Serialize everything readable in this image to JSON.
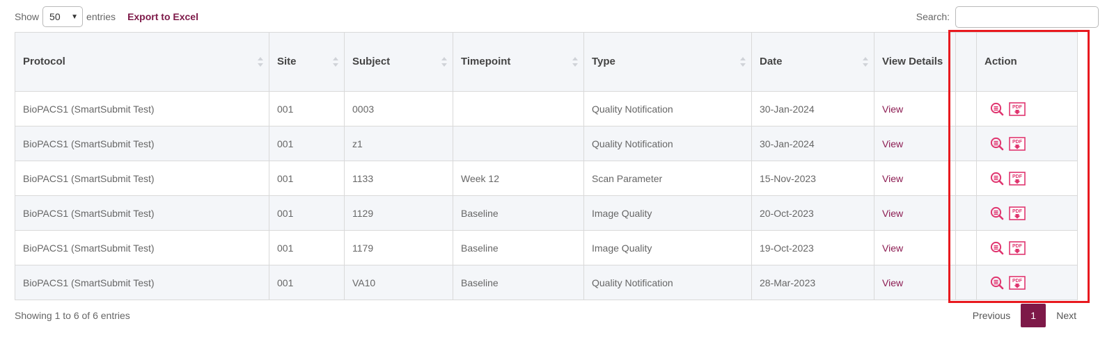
{
  "length_control": {
    "show_label": "Show",
    "selected": "50",
    "entries_label": "entries"
  },
  "export_label": "Export to Excel",
  "search": {
    "label": "Search:",
    "value": "",
    "placeholder": ""
  },
  "columns": [
    "Protocol",
    "Site",
    "Subject",
    "Timepoint",
    "Type",
    "Date",
    "View Details",
    "",
    "Action"
  ],
  "rows": [
    {
      "protocol": "BioPACS1 (SmartSubmit Test)",
      "site": "001",
      "subject": "0003",
      "timepoint": "",
      "type": "Quality Notification",
      "date": "30-Jan-2024",
      "view": "View"
    },
    {
      "protocol": "BioPACS1 (SmartSubmit Test)",
      "site": "001",
      "subject": "z1",
      "timepoint": "",
      "type": "Quality Notification",
      "date": "30-Jan-2024",
      "view": "View"
    },
    {
      "protocol": "BioPACS1 (SmartSubmit Test)",
      "site": "001",
      "subject": "1133",
      "timepoint": "Week 12",
      "type": "Scan Parameter",
      "date": "15-Nov-2023",
      "view": "View"
    },
    {
      "protocol": "BioPACS1 (SmartSubmit Test)",
      "site": "001",
      "subject": "1129",
      "timepoint": "Baseline",
      "type": "Image Quality",
      "date": "20-Oct-2023",
      "view": "View"
    },
    {
      "protocol": "BioPACS1 (SmartSubmit Test)",
      "site": "001",
      "subject": "1179",
      "timepoint": "Baseline",
      "type": "Image Quality",
      "date": "19-Oct-2023",
      "view": "View"
    },
    {
      "protocol": "BioPACS1 (SmartSubmit Test)",
      "site": "001",
      "subject": "VA10",
      "timepoint": "Baseline",
      "type": "Quality Notification",
      "date": "28-Mar-2023",
      "view": "View"
    }
  ],
  "row_action_icons": [
    "view-details-icon",
    "pdf-download-icon"
  ],
  "icon_pdf_text": "PDF",
  "footer": {
    "info": "Showing 1 to 6 of 6 entries",
    "previous": "Previous",
    "current_page": "1",
    "next": "Next"
  },
  "colors": {
    "accent": "#7d1948",
    "link": "#8c1c52",
    "icon": "#e0356f",
    "highlight": "#e8191f",
    "row_alt": "#f4f6f9"
  }
}
